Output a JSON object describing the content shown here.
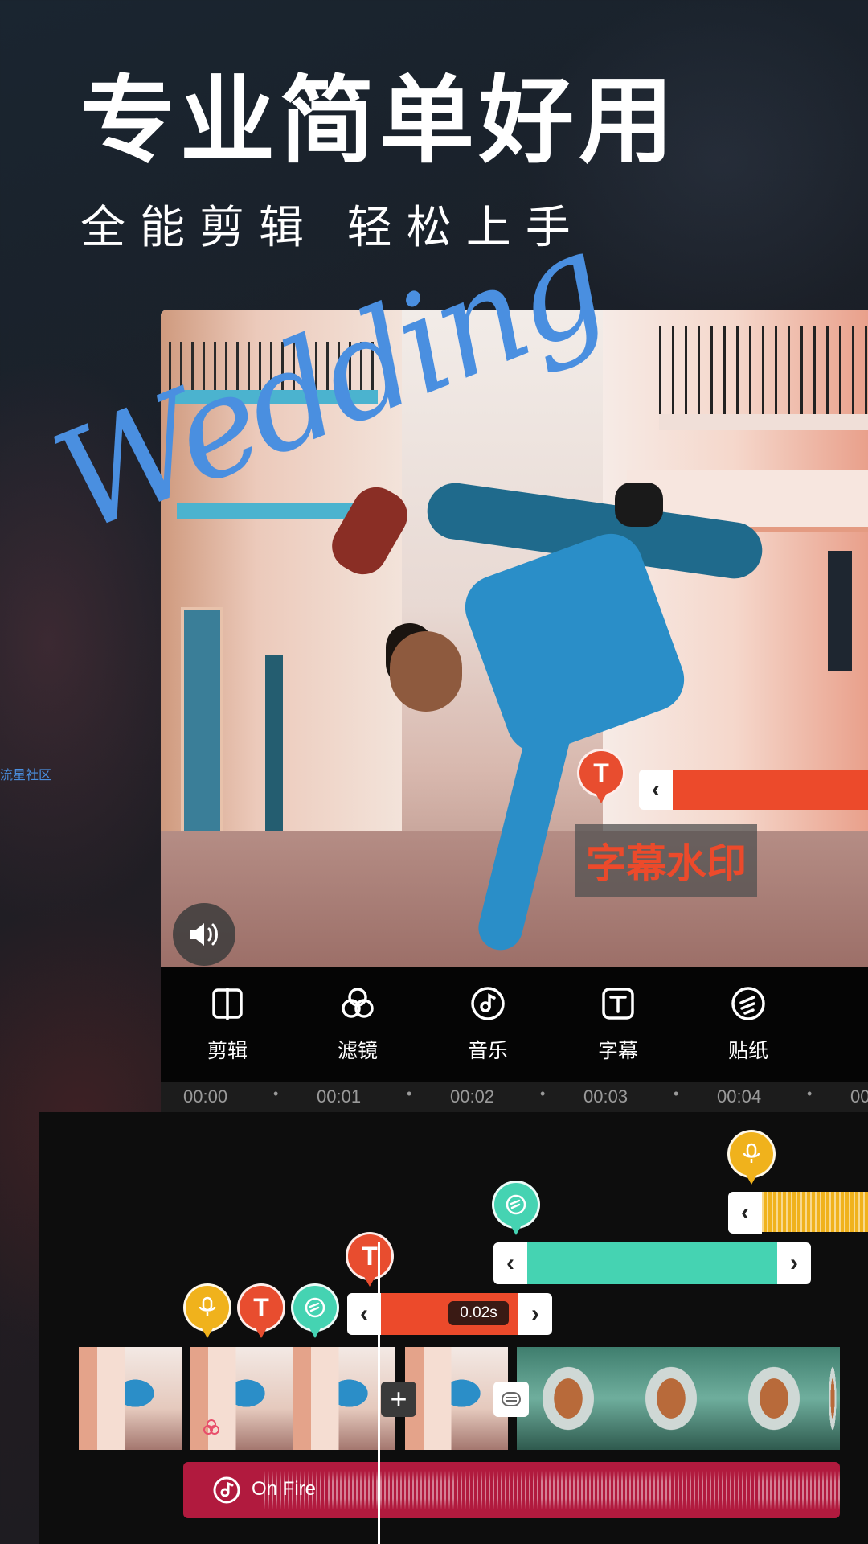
{
  "headline": "专业简单好用",
  "subheadline": "全能剪辑  轻松上手",
  "side_watermark": "流星社区",
  "preview": {
    "script_text": "Wedding",
    "subtitle_watermark": "字幕水印",
    "text_pin_label": "T"
  },
  "toolbar": {
    "items": [
      {
        "label": "剪辑",
        "icon": "trim-icon"
      },
      {
        "label": "滤镜",
        "icon": "filter-icon"
      },
      {
        "label": "音乐",
        "icon": "music-icon"
      },
      {
        "label": "字幕",
        "icon": "subtitle-icon"
      },
      {
        "label": "贴纸",
        "icon": "sticker-icon"
      }
    ]
  },
  "ruler": {
    "ticks": [
      "00:00",
      "00:01",
      "00:02",
      "00:03",
      "00:04",
      "00"
    ]
  },
  "timeline": {
    "text_pin_label": "T",
    "duration_badge": "0.02s",
    "plus_label": "+",
    "audio_track": {
      "title": "On Fire"
    }
  },
  "colors": {
    "red": "#ec4a2b",
    "teal": "#45d3b2",
    "yellow": "#f0b21c",
    "audio": "#b11a3e",
    "blue_script": "#4a8fe0"
  }
}
